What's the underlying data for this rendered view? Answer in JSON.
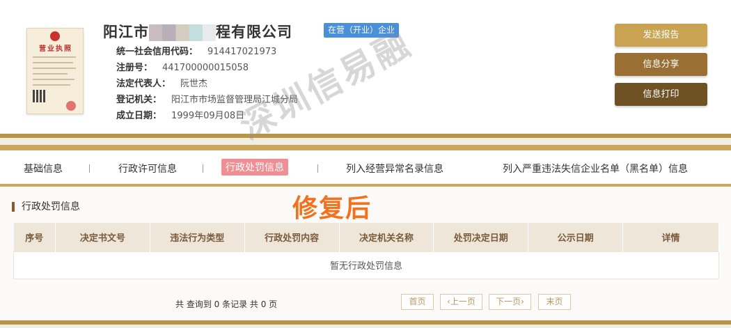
{
  "company": {
    "name_prefix": "阳江市",
    "name_suffix": "程有限公司",
    "status": "在营（开业）企业"
  },
  "license": {
    "title": "营业执照"
  },
  "info": [
    {
      "label": "统一社会信用代码：",
      "value": "914417021973"
    },
    {
      "label": "注册号：",
      "value": "441700000015058"
    },
    {
      "label": "法定代表人：",
      "value": "阮世杰"
    },
    {
      "label": "登记机关：",
      "value": "阳江市市场监督管理局江城分局"
    },
    {
      "label": "成立日期：",
      "value": "1999年09月08日"
    }
  ],
  "actions": {
    "send_report": "发送报告",
    "share": "信息分享",
    "print": "信息打印"
  },
  "tabs": [
    "基础信息",
    "行政许可信息",
    "行政处罚信息",
    "列入经营异常名录信息",
    "列入严重违法失信企业名单（黑名单）信息"
  ],
  "section": {
    "title": "行政处罚信息",
    "overlay_text": "修复后",
    "watermark": "深圳信易融",
    "columns": [
      "序号",
      "决定书文号",
      "违法行为类型",
      "行政处罚内容",
      "决定机关名称",
      "处罚决定日期",
      "公示日期",
      "详情"
    ],
    "empty_message": "暂无行政处罚信息"
  },
  "pagination": {
    "summary": "共 查询到 0 条记录 共 0 页",
    "first": "首页",
    "prev": "‹上一页",
    "next": "下一页›",
    "last": "末页"
  },
  "colors": {
    "gold": "#b89648",
    "status_blue": "#4a90d9",
    "btn1": "#c9a352",
    "btn2": "#9a6f34",
    "btn3": "#6e5224",
    "active_tab": "#ef8f93"
  }
}
